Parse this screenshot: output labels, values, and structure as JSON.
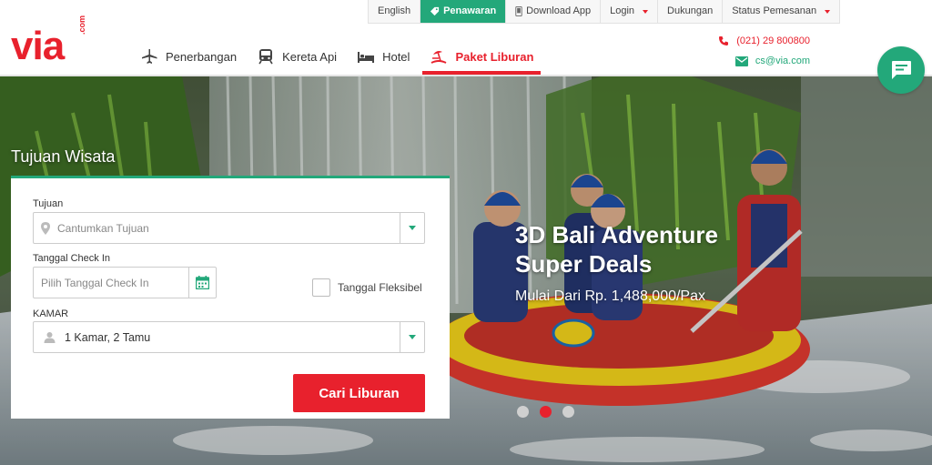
{
  "topbar": {
    "items": [
      {
        "label": "English",
        "active": false,
        "caret": false
      },
      {
        "label": "Penawaran",
        "active": true,
        "caret": false
      },
      {
        "label": "Download App",
        "active": false,
        "caret": false
      },
      {
        "label": "Login",
        "active": false,
        "caret": true
      },
      {
        "label": "Dukungan",
        "active": false,
        "caret": false
      },
      {
        "label": "Status Pemesanan",
        "active": false,
        "caret": true
      }
    ]
  },
  "logo": {
    "text": "via",
    "suffix": ".com"
  },
  "nav": {
    "items": [
      {
        "label": "Penerbangan",
        "icon": "airplane-icon",
        "active": false
      },
      {
        "label": "Kereta Api",
        "icon": "train-icon",
        "active": false
      },
      {
        "label": "Hotel",
        "icon": "bed-icon",
        "active": false
      },
      {
        "label": "Paket Liburan",
        "icon": "beach-icon",
        "active": true
      }
    ]
  },
  "contact": {
    "phone": "(021) 29 800800",
    "email": "cs@via.com"
  },
  "search": {
    "panel_title": "Tujuan Wisata",
    "destination_label": "Tujuan",
    "destination_placeholder": "Cantumkan Tujuan",
    "checkin_label": "Tanggal Check In",
    "checkin_placeholder": "Pilih Tanggal Check In",
    "flexible_label": "Tanggal Fleksibel",
    "room_label": "KAMAR",
    "room_value": "1 Kamar, 2 Tamu",
    "submit_label": "Cari Liburan"
  },
  "hero": {
    "title_line1": "3D Bali Adventure",
    "title_line2": "Super Deals",
    "subtitle": "Mulai Dari Rp. 1,488,000/Pax",
    "slides": 3,
    "active_slide": 2
  },
  "colors": {
    "brand_red": "#e8212d",
    "brand_green": "#23a87a"
  }
}
